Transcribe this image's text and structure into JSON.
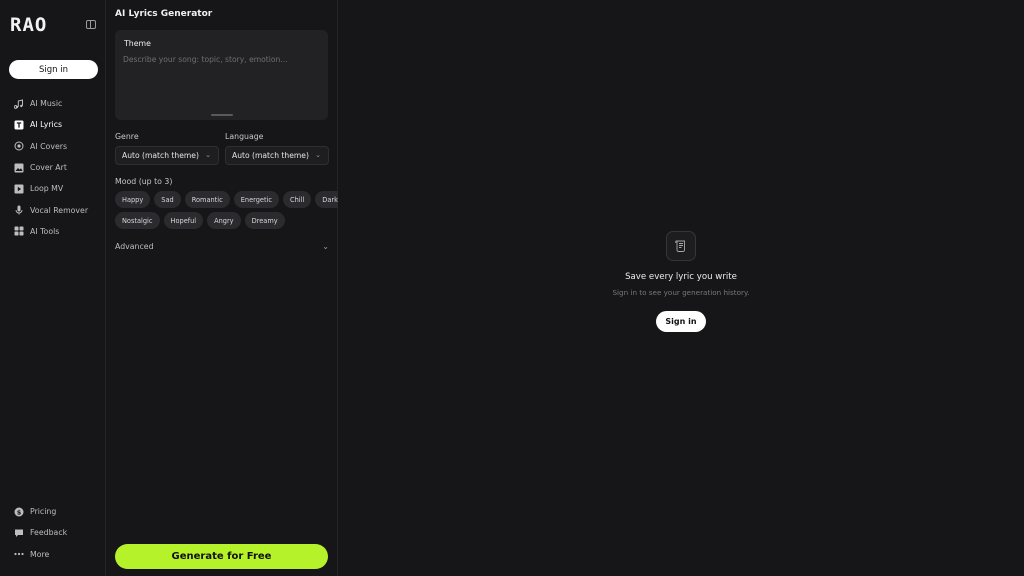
{
  "sidebar": {
    "logo": "RAO",
    "sign_in": "Sign in",
    "items": [
      {
        "label": "AI Music",
        "icon": "music-note-icon",
        "active": false
      },
      {
        "label": "AI Lyrics",
        "icon": "lyrics-t-icon",
        "active": true
      },
      {
        "label": "AI Covers",
        "icon": "covers-icon",
        "active": false
      },
      {
        "label": "Cover Art",
        "icon": "image-icon",
        "active": false
      },
      {
        "label": "Loop MV",
        "icon": "play-icon",
        "active": false
      },
      {
        "label": "Vocal Remover",
        "icon": "microphone-icon",
        "active": false
      },
      {
        "label": "AI Tools",
        "icon": "grid-icon",
        "active": false
      }
    ],
    "bottom": [
      {
        "label": "Pricing",
        "icon": "dollar-icon"
      },
      {
        "label": "Feedback",
        "icon": "chat-icon"
      },
      {
        "label": "More",
        "icon": "more-dots-icon"
      }
    ]
  },
  "panel": {
    "title": "AI Lyrics Generator",
    "theme_label": "Theme",
    "theme_placeholder": "Describe your song: topic, story, emotion...",
    "genre_label": "Genre",
    "genre_value": "Auto (match theme)",
    "language_label": "Language",
    "language_value": "Auto (match theme)",
    "mood_label": "Mood (up to 3)",
    "moods_row1": [
      "Happy",
      "Sad",
      "Romantic",
      "Energetic",
      "Chill",
      "Dark"
    ],
    "moods_row2": [
      "Nostalgic",
      "Hopeful",
      "Angry",
      "Dreamy"
    ],
    "advanced_label": "Advanced",
    "generate_label": "Generate for Free"
  },
  "main": {
    "empty_title": "Save every lyric you write",
    "empty_subtitle": "Sign in to see your generation history.",
    "sign_in": "Sign in"
  },
  "colors": {
    "background": "#161618",
    "accent": "#b6f22a"
  }
}
